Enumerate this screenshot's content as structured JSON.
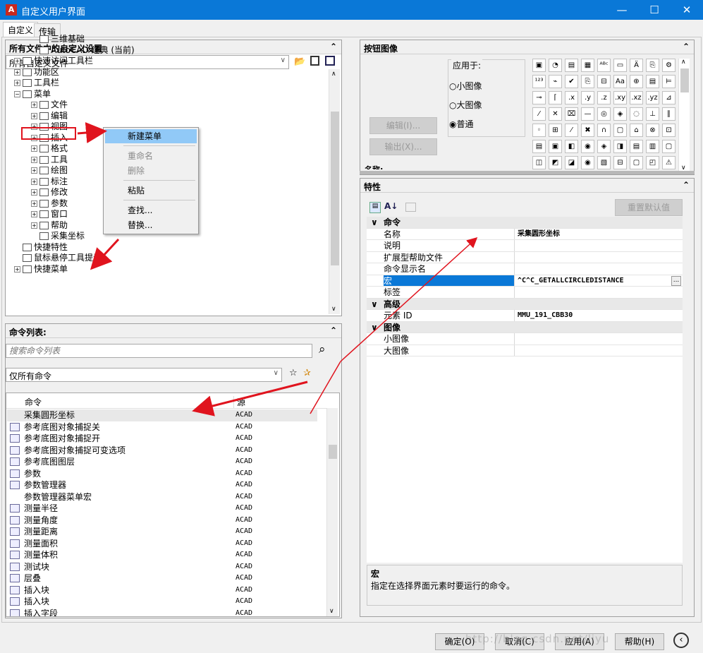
{
  "window": {
    "title": "自定义用户界面",
    "minimize": "—",
    "maximize": "☐",
    "close": "✕"
  },
  "tabs": [
    "自定义",
    "传输"
  ],
  "customizations": {
    "header": "所有文件中的自定义设置",
    "combo": "所有自定义文件",
    "tree": [
      {
        "label": "三维基础",
        "indent": 4,
        "expander": ""
      },
      {
        "label": "AutoCAD 经典 (当前)",
        "indent": 4,
        "expander": ""
      },
      {
        "label": "快速访问工具栏",
        "indent": 1,
        "expander": "+"
      },
      {
        "label": "功能区",
        "indent": 1,
        "expander": "+"
      },
      {
        "label": "工具栏",
        "indent": 1,
        "expander": "+"
      },
      {
        "label": "菜单",
        "indent": 1,
        "expander": "−"
      },
      {
        "label": "文件",
        "indent": 3,
        "expander": "+"
      },
      {
        "label": "编辑",
        "indent": 3,
        "expander": "+"
      },
      {
        "label": "视图",
        "indent": 3,
        "expander": "+"
      },
      {
        "label": "插入",
        "indent": 3,
        "expander": "+"
      },
      {
        "label": "格式",
        "indent": 3,
        "expander": "+"
      },
      {
        "label": "工具",
        "indent": 3,
        "expander": "+"
      },
      {
        "label": "绘图",
        "indent": 3,
        "expander": "+"
      },
      {
        "label": "标注",
        "indent": 3,
        "expander": "+"
      },
      {
        "label": "修改",
        "indent": 3,
        "expander": "+"
      },
      {
        "label": "参数",
        "indent": 3,
        "expander": "+"
      },
      {
        "label": "窗口",
        "indent": 3,
        "expander": "+"
      },
      {
        "label": "帮助",
        "indent": 3,
        "expander": "+"
      },
      {
        "label": "采集坐标",
        "indent": 4,
        "expander": ""
      },
      {
        "label": "快捷特性",
        "indent": 2,
        "expander": ""
      },
      {
        "label": "鼠标悬停工具提示",
        "indent": 2,
        "expander": ""
      },
      {
        "label": "快捷菜单",
        "indent": 1,
        "expander": "+"
      }
    ],
    "context_menu": [
      "新建菜单",
      "重命名",
      "删除",
      "粘贴",
      "查找...",
      "替换..."
    ]
  },
  "command_list": {
    "header": "命令列表:",
    "search_placeholder": "搜索命令列表",
    "filter": "仅所有命令",
    "col_command": "命令",
    "col_source": "源",
    "rows": [
      {
        "name": "采集圆形坐标",
        "source": "ACAD"
      },
      {
        "name": "参考底图对象捕捉关",
        "source": "ACAD"
      },
      {
        "name": "参考底图对象捕捉开",
        "source": "ACAD"
      },
      {
        "name": "参考底图对象捕捉可变选项",
        "source": "ACAD"
      },
      {
        "name": "参考底图图层",
        "source": "ACAD"
      },
      {
        "name": "参数",
        "source": "ACAD"
      },
      {
        "name": "参数管理器",
        "source": "ACAD"
      },
      {
        "name": "参数管理器菜单宏",
        "source": "ACAD"
      },
      {
        "name": "测量半径",
        "source": "ACAD"
      },
      {
        "name": "测量角度",
        "source": "ACAD"
      },
      {
        "name": "测量距离",
        "source": "ACAD"
      },
      {
        "name": "测量面积",
        "source": "ACAD"
      },
      {
        "name": "测量体积",
        "source": "ACAD"
      },
      {
        "name": "测试块",
        "source": "ACAD"
      },
      {
        "name": "层叠",
        "source": "ACAD"
      },
      {
        "name": "插入块",
        "source": "ACAD"
      },
      {
        "name": "插入块",
        "source": "ACAD"
      },
      {
        "name": "插入字段",
        "source": "ACAD"
      }
    ]
  },
  "button_image": {
    "header": "按钮图像",
    "apply_to": "应用于:",
    "edit": "编辑(I)...",
    "export": "输出(X)...",
    "options": [
      "小图像",
      "大图像",
      "普通"
    ],
    "selected": "普通",
    "name_label": "名称:"
  },
  "properties": {
    "header": "特性",
    "reset": "重置默认值",
    "rows": [
      {
        "type": "cat",
        "key": "命令",
        "value": ""
      },
      {
        "type": "row",
        "key": "名称",
        "value": "采集圆形坐标"
      },
      {
        "type": "row",
        "key": "说明",
        "value": ""
      },
      {
        "type": "row",
        "key": "扩展型帮助文件",
        "value": ""
      },
      {
        "type": "row",
        "key": "命令显示名",
        "value": ""
      },
      {
        "type": "sel",
        "key": "宏",
        "value": "^C^C_GETALLCIRCLEDISTANCE"
      },
      {
        "type": "row",
        "key": "标签",
        "value": ""
      },
      {
        "type": "cat",
        "key": "高级",
        "value": ""
      },
      {
        "type": "row",
        "key": "元素 ID",
        "value": "MMU_191_CBB30"
      },
      {
        "type": "cat",
        "key": "图像",
        "value": ""
      },
      {
        "type": "row",
        "key": "小图像",
        "value": ""
      },
      {
        "type": "row",
        "key": "大图像",
        "value": ""
      }
    ],
    "desc_title": "宏",
    "desc_text": "指定在选择界面元素时要运行的命令。"
  },
  "footer": {
    "ok": "确定(O)",
    "cancel": "取消(C)",
    "apply": "应用(A)",
    "help": "帮助(H)"
  },
  "watermark": "http://blog.csdn.net/liyu"
}
